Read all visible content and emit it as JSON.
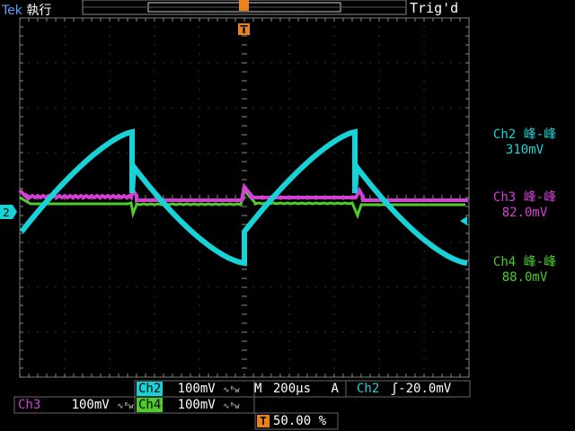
{
  "header": {
    "brand": "Tek",
    "run_state": "執行",
    "trigger_status": "Trig'd",
    "trigger_marker": "T"
  },
  "channels": {
    "ch2": {
      "label": "Ch2",
      "scale": "100mV",
      "color": "#17d3d8"
    },
    "ch3": {
      "label": "Ch3",
      "scale": "100mV",
      "color": "#d43fd6"
    },
    "ch4": {
      "label": "Ch4",
      "scale": "100mV",
      "color": "#4dcc2a"
    },
    "ground_marker": "2",
    "bw_icon": "bandwidth-limit-icon"
  },
  "measurements": [
    {
      "label": "Ch2 峰-峰",
      "value": "310mV",
      "color": "#17d3d8"
    },
    {
      "label": "Ch3 峰-峰",
      "value": "82.0mV",
      "color": "#d43fd6"
    },
    {
      "label": "Ch4 峰-峰",
      "value": "88.0mV",
      "color": "#4dcc2a"
    }
  ],
  "timebase": {
    "mode": "M",
    "scale": "200µs",
    "trigger_type": "A",
    "trigger_source": "Ch2",
    "trigger_slope_icon": "rising-edge-icon",
    "trigger_level": "-20.0mV",
    "position_icon": "T",
    "position": "50.00 %"
  }
}
